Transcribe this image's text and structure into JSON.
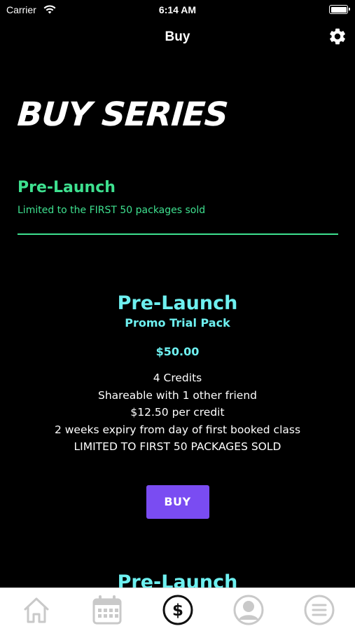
{
  "status_bar": {
    "carrier": "Carrier",
    "time": "6:14 AM",
    "icons": [
      "wifi-icon",
      "battery-icon"
    ]
  },
  "nav": {
    "title": "Buy",
    "settings_icon": "gear-icon"
  },
  "page": {
    "heading": "BUY SERIES"
  },
  "section": {
    "title": "Pre-Launch",
    "subtitle": "Limited to the FIRST 50 packages sold",
    "accent_color": "#3ee08f"
  },
  "packages": [
    {
      "title": "Pre-Launch",
      "subtitle": "Promo Trial Pack",
      "price": "$50.00",
      "features": [
        "4 Credits",
        "Shareable with 1 other friend",
        "$12.50 per credit",
        "2 weeks expiry from day of first booked class",
        "LIMITED TO FIRST 50 PACKAGES SOLD"
      ],
      "button_label": "BUY",
      "button_color": "#7a4cf2",
      "title_color": "#6ef0f0"
    },
    {
      "title": "Pre-Launch"
    }
  ],
  "tab_bar": {
    "tabs": [
      {
        "icon": "home-icon",
        "active": false
      },
      {
        "icon": "calendar-icon",
        "active": false
      },
      {
        "icon": "dollar-icon",
        "active": true
      },
      {
        "icon": "profile-icon",
        "active": false
      },
      {
        "icon": "menu-icon",
        "active": false
      }
    ]
  }
}
